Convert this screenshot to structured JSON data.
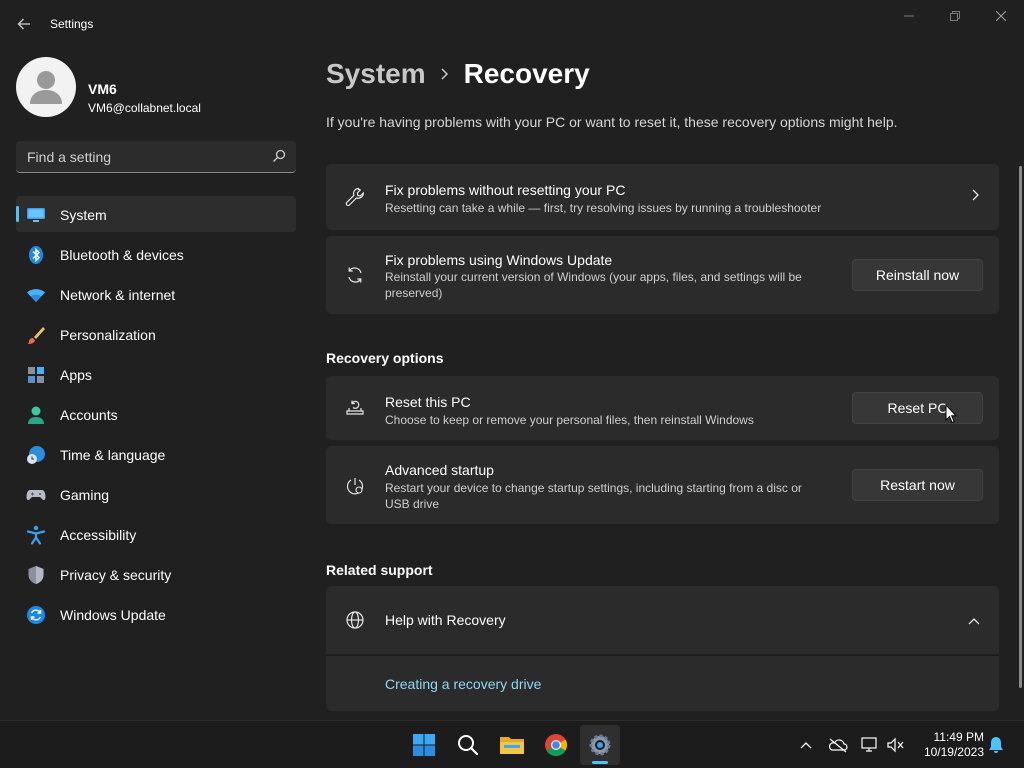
{
  "window": {
    "app_title": "Settings"
  },
  "profile": {
    "name": "VM6",
    "email": "VM6@collabnet.local"
  },
  "search": {
    "placeholder": "Find a setting"
  },
  "sidebar": {
    "items": [
      {
        "label": "System",
        "icon": "monitor-icon",
        "active": true
      },
      {
        "label": "Bluetooth & devices",
        "icon": "bluetooth-icon"
      },
      {
        "label": "Network & internet",
        "icon": "wifi-icon"
      },
      {
        "label": "Personalization",
        "icon": "brush-icon"
      },
      {
        "label": "Apps",
        "icon": "apps-icon"
      },
      {
        "label": "Accounts",
        "icon": "person-icon"
      },
      {
        "label": "Time & language",
        "icon": "globe-clock-icon"
      },
      {
        "label": "Gaming",
        "icon": "gamepad-icon"
      },
      {
        "label": "Accessibility",
        "icon": "accessibility-icon"
      },
      {
        "label": "Privacy & security",
        "icon": "shield-icon"
      },
      {
        "label": "Windows Update",
        "icon": "update-icon"
      }
    ]
  },
  "main": {
    "breadcrumb": {
      "parent": "System",
      "current": "Recovery"
    },
    "intro": "If you're having problems with your PC or want to reset it, these recovery options might help.",
    "fix_troubleshoot": {
      "title": "Fix problems without resetting your PC",
      "description": "Resetting can take a while — first, try resolving issues by running a troubleshooter"
    },
    "fix_update": {
      "title": "Fix problems using Windows Update",
      "description_line1": "Reinstall your current version of Windows (your apps, files, and settings will be",
      "description_line2": "preserved)",
      "button": "Reinstall now"
    },
    "recovery_options_heading": "Recovery options",
    "reset_pc": {
      "title": "Reset this PC",
      "description": "Choose to keep or remove your personal files, then reinstall Windows",
      "button": "Reset PC"
    },
    "advanced_startup": {
      "title": "Advanced startup",
      "description_line1": "Restart your device to change startup settings, including starting from a disc or",
      "description_line2": "USB drive",
      "button": "Restart now"
    },
    "related_support_heading": "Related support",
    "help": {
      "title": "Help with Recovery",
      "link": "Creating a recovery drive"
    }
  },
  "taskbar": {
    "apps": [
      "start-icon",
      "search-icon",
      "file-explorer-icon",
      "chrome-icon",
      "settings-icon"
    ],
    "tray": [
      "chevron-up-icon",
      "onedrive-off-icon",
      "network-icon",
      "volume-mute-icon",
      "notification-bell-icon"
    ],
    "time": "11:49 PM",
    "date": "10/19/2023"
  },
  "colors": {
    "accent": "#4cc2ff",
    "background": "#202020",
    "card": "#2b2b2b",
    "link": "#8fd8f8"
  }
}
